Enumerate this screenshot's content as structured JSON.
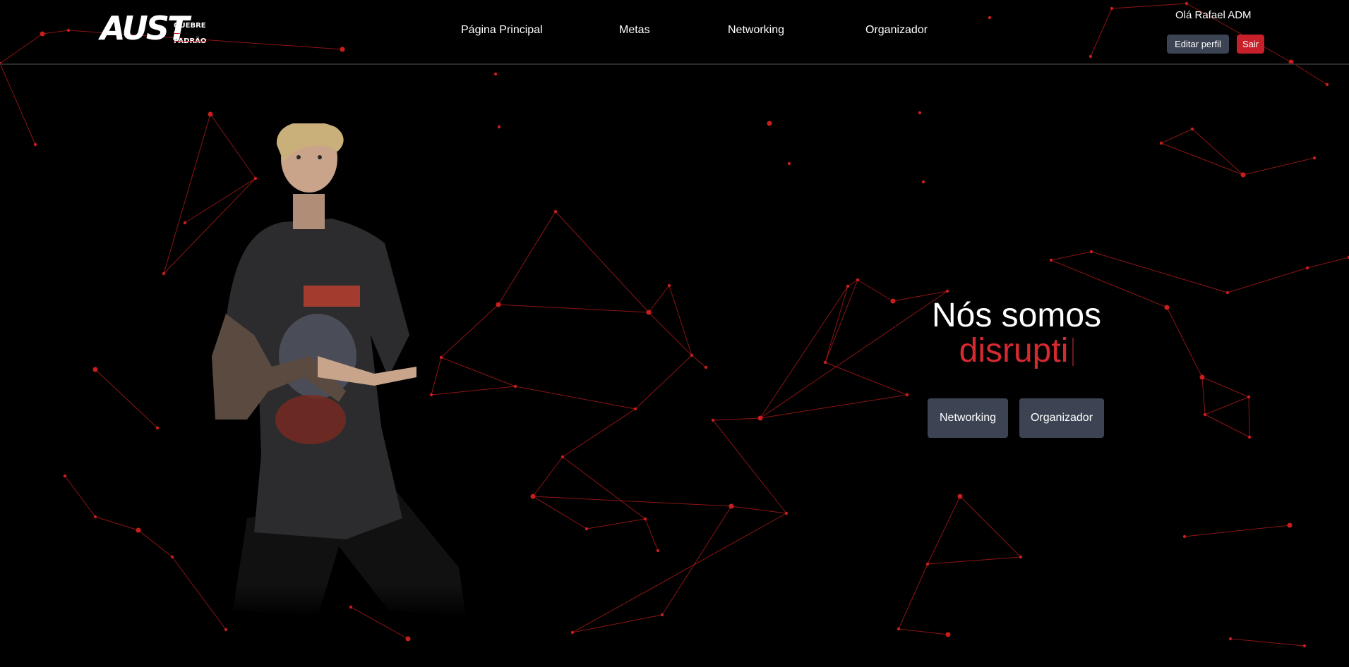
{
  "logo": {
    "main": "AUST",
    "line1": "QUEBRE",
    "line2": "O PADRÃO"
  },
  "nav": {
    "items": [
      {
        "label": "Página Principal"
      },
      {
        "label": "Metas"
      },
      {
        "label": "Networking"
      },
      {
        "label": "Organizador"
      }
    ]
  },
  "user": {
    "greeting": "Olá Rafael ADM",
    "edit_label": "Editar perfil",
    "logout_label": "Sair"
  },
  "hero": {
    "title": "Nós somos",
    "typed_text": "disrupti",
    "buttons": [
      {
        "label": "Networking"
      },
      {
        "label": "Organizador"
      }
    ]
  },
  "colors": {
    "background": "#000000",
    "accent_red": "#c8202a",
    "button_gray": "#3c4454",
    "particle_red": "#c81e1e"
  },
  "icons": {
    "shirt_graphic": "band-tshirt-print",
    "hero_image": "person-photo"
  }
}
